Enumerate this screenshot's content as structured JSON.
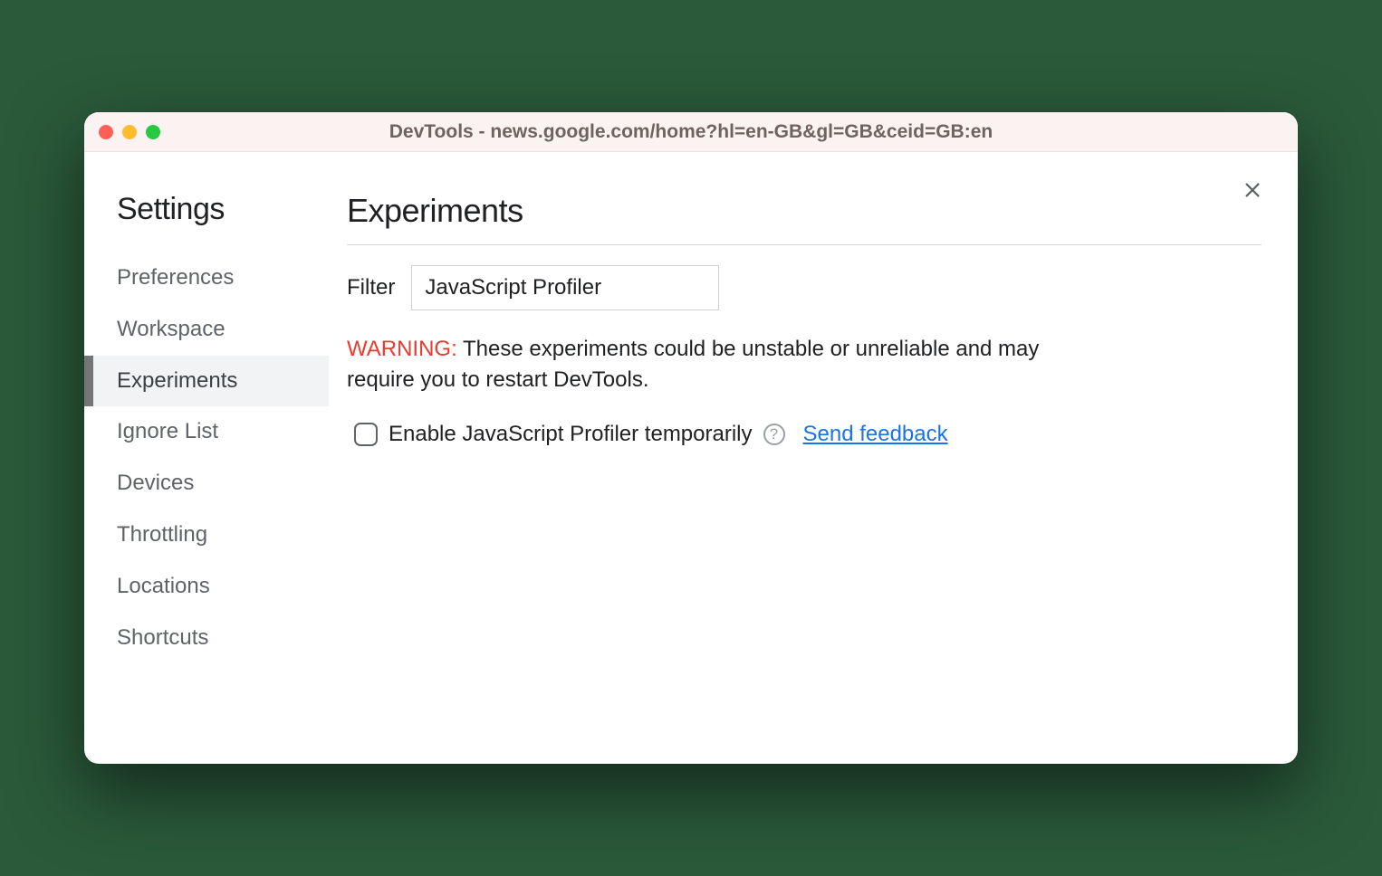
{
  "window": {
    "title": "DevTools - news.google.com/home?hl=en-GB&gl=GB&ceid=GB:en"
  },
  "sidebar": {
    "title": "Settings",
    "items": [
      {
        "label": "Preferences",
        "selected": false
      },
      {
        "label": "Workspace",
        "selected": false
      },
      {
        "label": "Experiments",
        "selected": true
      },
      {
        "label": "Ignore List",
        "selected": false
      },
      {
        "label": "Devices",
        "selected": false
      },
      {
        "label": "Throttling",
        "selected": false
      },
      {
        "label": "Locations",
        "selected": false
      },
      {
        "label": "Shortcuts",
        "selected": false
      }
    ]
  },
  "main": {
    "title": "Experiments",
    "filter": {
      "label": "Filter",
      "value": "JavaScript Profiler"
    },
    "warning": {
      "label": "WARNING:",
      "text": " These experiments could be unstable or unreliable and may require you to restart DevTools."
    },
    "experiment": {
      "checked": false,
      "label": "Enable JavaScript Profiler temporarily",
      "help_glyph": "?",
      "feedback": "Send feedback"
    }
  }
}
